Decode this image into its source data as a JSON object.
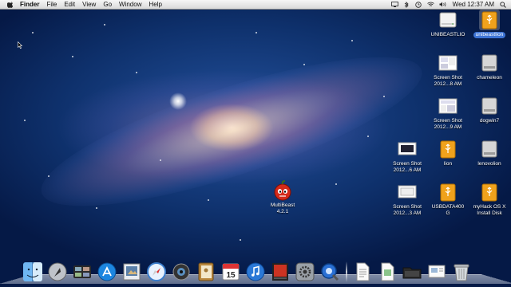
{
  "menubar": {
    "items": [
      "Finder",
      "File",
      "Edit",
      "View",
      "Go",
      "Window",
      "Help"
    ],
    "clock": "Wed 12:37 AM"
  },
  "desktop_icons": [
    {
      "label": "UNIBEASTLIO",
      "icon": "drive-icon",
      "selected": false
    },
    {
      "label": "unibeastlion",
      "icon": "usb-drive-icon",
      "selected": true
    },
    {
      "label": "Screen Shot\n2012...8 AM",
      "icon": "screenshot-icon",
      "selected": false
    },
    {
      "label": "chameleon",
      "icon": "drive-icon",
      "selected": false
    },
    {
      "label": "Screen Shot\n2012...9 AM",
      "icon": "screenshot-icon",
      "selected": false
    },
    {
      "label": "dogwin7",
      "icon": "drive-icon",
      "selected": false
    },
    {
      "label": "Screen Shot\n2012...6 AM",
      "icon": "screenshot-icon",
      "selected": false
    },
    {
      "label": "lion",
      "icon": "usb-drive-icon",
      "selected": false
    },
    {
      "label": "lenovolion",
      "icon": "drive-icon",
      "selected": false
    },
    {
      "label": "Screen Shot\n2012...3 AM",
      "icon": "screenshot-icon",
      "selected": false
    },
    {
      "label": "USBDATA400\nG",
      "icon": "usb-drive-icon",
      "selected": false
    },
    {
      "label": "myHack OS X\nInstall Disk",
      "icon": "usb-drive-icon",
      "selected": false
    },
    {
      "label": "MultiBeast\n4.2.1",
      "icon": "multibeast-icon",
      "selected": false
    }
  ],
  "dock": {
    "calendar_day": "15",
    "items": [
      "finder-icon",
      "launchpad-icon",
      "mission-control-icon",
      "app-store-icon",
      "preview-icon",
      "safari-icon",
      "photo-booth-icon",
      "address-book-icon",
      "ical-icon",
      "itunes-icon",
      "photo-app-icon",
      "system-preferences-icon",
      "quicktime-icon",
      "document-icon",
      "document-icon",
      "folder-icon",
      "document-icon",
      "trash-icon"
    ]
  },
  "colors": {
    "selection": "#3d74d6",
    "usb_orange": "#f0a21c",
    "menubar": "#e6e6e6"
  }
}
